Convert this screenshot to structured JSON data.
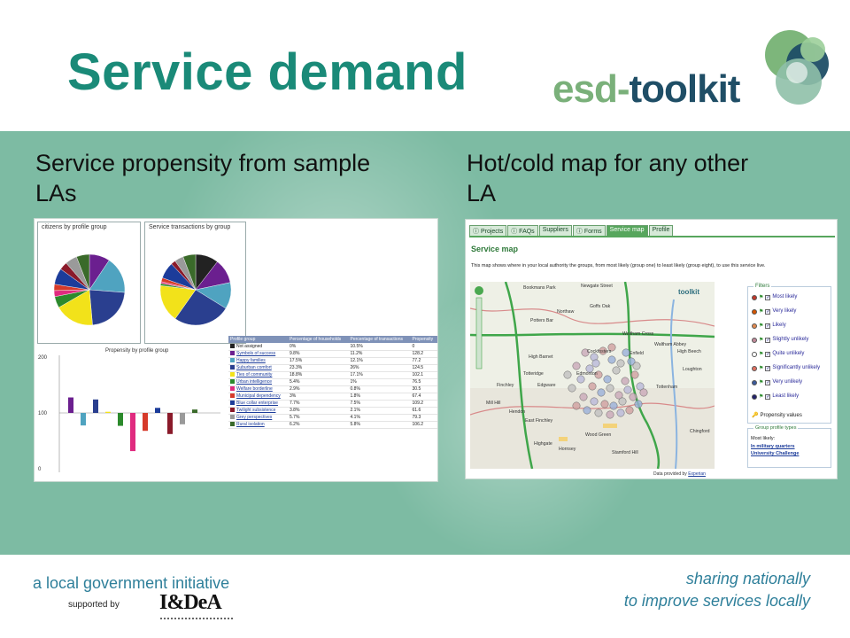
{
  "slide": {
    "title": "Service demand",
    "logo": {
      "part1": "esd-",
      "part2": "toolkit"
    },
    "left_heading": "Service propensity from sample LAs",
    "right_heading": "Hot/cold map for any other LA"
  },
  "left_screenshot": {
    "pie1_title": "citizens by profile group",
    "pie2_title": "Service transactions by group",
    "bar_title": "Propensity by profile group",
    "bar_axis_ticks": [
      "200",
      "100",
      "0"
    ],
    "table_headers": [
      "Profile group",
      "Percentage of households",
      "Percentage of transactions",
      "Propensity"
    ],
    "table_rows": [
      {
        "name": "Not assigned",
        "hh": "0%",
        "tx": "10.5%",
        "p": "0"
      },
      {
        "name": "Symbols of success",
        "hh": "9.8%",
        "tx": "11.2%",
        "p": "128.2"
      },
      {
        "name": "Happy families",
        "hh": "17.5%",
        "tx": "12.1%",
        "p": "77.2"
      },
      {
        "name": "Suburban comfort",
        "hh": "23.3%",
        "tx": "26%",
        "p": "124.5"
      },
      {
        "name": "Ties of community",
        "hh": "18.8%",
        "tx": "17.1%",
        "p": "102.1"
      },
      {
        "name": "Urban intelligence",
        "hh": "5.4%",
        "tx": "1%",
        "p": "76.5"
      },
      {
        "name": "Welfare borderline",
        "hh": "2.9%",
        "tx": "0.8%",
        "p": "30.5"
      },
      {
        "name": "Municipal dependency",
        "hh": "3%",
        "tx": "1.8%",
        "p": "67.4"
      },
      {
        "name": "Blue collar enterprise",
        "hh": "7.7%",
        "tx": "7.5%",
        "p": "109.2"
      },
      {
        "name": "Twilight subsistence",
        "hh": "3.8%",
        "tx": "2.1%",
        "p": "61.6"
      },
      {
        "name": "Grey perspectives",
        "hh": "5.7%",
        "tx": "4.1%",
        "p": "79.3"
      },
      {
        "name": "Rural isolation",
        "hh": "6.2%",
        "tx": "5.8%",
        "p": "106.2"
      }
    ],
    "colors": [
      "#222222",
      "#6b1f8f",
      "#4fa3c0",
      "#2a3f8f",
      "#f2e21a",
      "#2c8a2c",
      "#e02b7f",
      "#d63a2a",
      "#1c3c9a",
      "#8a1a2a",
      "#9a9a9a",
      "#3a6a2a"
    ]
  },
  "right_screenshot": {
    "tabs": [
      "Projects",
      "FAQs",
      "Suppliers",
      "Forms",
      "Service map",
      "Profile"
    ],
    "active_tab": "Service map",
    "title": "Service map",
    "description": "This map shows where in your local authority the groups, from most likely (group one) to least likely (group eight), to use this service live.",
    "map_places": [
      "Bookmans Park",
      "Newgate Street",
      "Goffs Oak",
      "Northaw",
      "Potters Bar",
      "Waltham Cross",
      "Waltham Abbey",
      "High Barnet",
      "Enfield",
      "Cockfosters",
      "Edmonton",
      "Totteridge",
      "Edgware",
      "Mill Hill",
      "Finchley",
      "Hendon",
      "East Finchley",
      "Highgate",
      "Hornsey",
      "Wood Green",
      "Tottenham",
      "Chingford",
      "Loughton",
      "High Beech",
      "Stamford Hill"
    ],
    "map_watermark": "toolkit",
    "filters_title": "Filters",
    "filters": [
      "Most likely",
      "Very likely",
      "Likely",
      "Slightly unlikely",
      "Quite unlikely",
      "Significantly unlikely",
      "Very unlikely",
      "Least likely"
    ],
    "filter_colors": [
      "#c0392b",
      "#d35400",
      "#e08a50",
      "#c08a9a",
      "#ffffff",
      "#e07060",
      "#3a5a9a",
      "#22226a"
    ],
    "propensity_values": "Propensity values",
    "gpt_title": "Group profile types",
    "gpt_label": "Most likely:",
    "gpt_links": [
      "In military quarters",
      "University Challenge"
    ],
    "credit_label": "Data provided by",
    "credit_link": "Experian"
  },
  "footer": {
    "left": "a local government initiative",
    "supported": "supported by",
    "sponsor": "I&DeA",
    "right_line1": "sharing nationally",
    "right_line2": "to improve services locally"
  }
}
